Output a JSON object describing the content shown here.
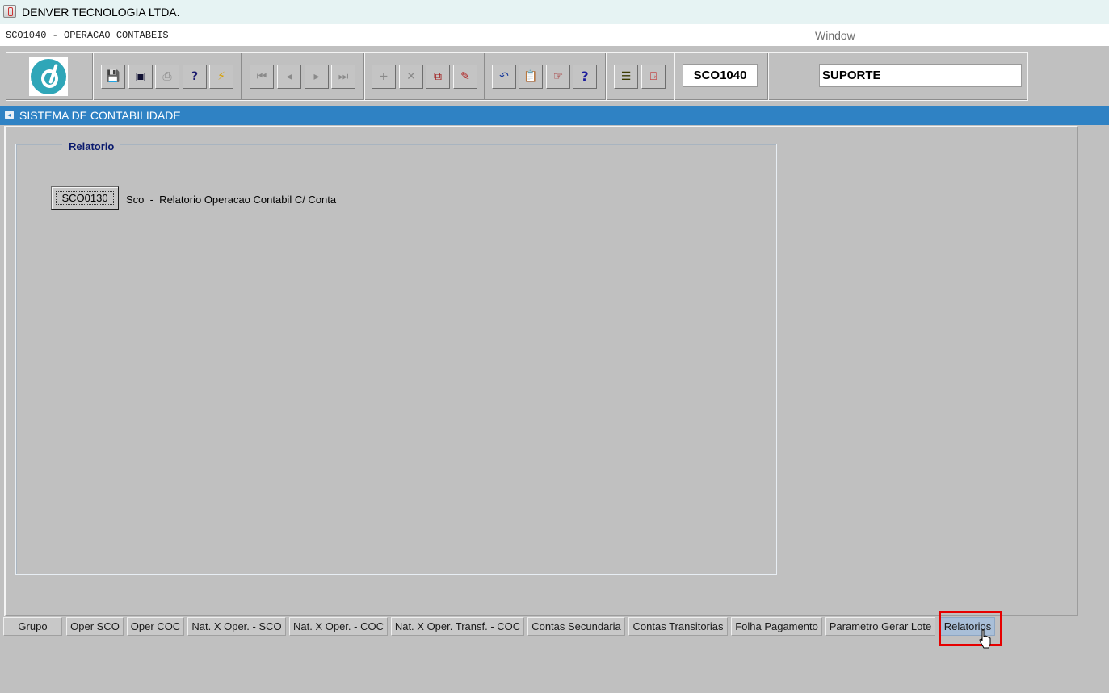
{
  "titlebar": {
    "title": "DENVER TECNOLOGIA LTDA.",
    "icon": "java-cup-icon"
  },
  "menubar": {
    "form_title": "SCO1040 - OPERACAO CONTABEIS",
    "window_menu": "Window"
  },
  "toolbar": {
    "logo": "denver-logo",
    "buttons": [
      {
        "icon": "save-icon",
        "glyph": "💾"
      },
      {
        "icon": "window-icon",
        "glyph": "▣"
      },
      {
        "icon": "print-icon",
        "glyph": "⎙"
      },
      {
        "icon": "query-help-icon",
        "glyph": "?"
      },
      {
        "icon": "execute-query-icon",
        "glyph": "⚡"
      },
      {
        "icon": "first-record-icon",
        "glyph": "⏮"
      },
      {
        "icon": "previous-record-icon",
        "glyph": "◂"
      },
      {
        "icon": "next-record-icon",
        "glyph": "▸"
      },
      {
        "icon": "last-record-icon",
        "glyph": "⏭"
      },
      {
        "icon": "insert-record-icon",
        "glyph": "+"
      },
      {
        "icon": "delete-record-icon",
        "glyph": "✕"
      },
      {
        "icon": "duplicate-record-icon",
        "glyph": "⧉"
      },
      {
        "icon": "edit-record-icon",
        "glyph": "✎"
      },
      {
        "icon": "undo-icon",
        "glyph": "↶"
      },
      {
        "icon": "clipboard-icon",
        "glyph": "📋"
      },
      {
        "icon": "list-values-icon",
        "glyph": "☞"
      },
      {
        "icon": "help-icon",
        "glyph": "?"
      },
      {
        "icon": "menu-icon",
        "glyph": "☰"
      },
      {
        "icon": "exit-icon",
        "glyph": "⍈"
      }
    ],
    "form_code": "SCO1040",
    "user": "SUPORTE"
  },
  "section": {
    "title": "SISTEMA DE CONTABILIDADE",
    "icon": "form-icon"
  },
  "group": {
    "label": "Relatorio",
    "report_button": "SCO0130",
    "report_description": "Sco  -  Relatorio Operacao Contabil C/ Conta"
  },
  "tabs": [
    {
      "label": "Grupo"
    },
    {
      "label": "Oper SCO"
    },
    {
      "label": "Oper COC"
    },
    {
      "label": "Nat. X Oper. - SCO"
    },
    {
      "label": "Nat. X Oper. - COC"
    },
    {
      "label": "Nat. X Oper. Transf. - COC"
    },
    {
      "label": "Contas Secundaria"
    },
    {
      "label": "Contas Transitorias"
    },
    {
      "label": "Folha Pagamento"
    },
    {
      "label": "Parametro Gerar Lote"
    },
    {
      "label": "Relatorios",
      "active": true
    }
  ],
  "colors": {
    "section_header": "#2f82c4",
    "highlight": "#e60000",
    "active_tab": "#a9bfd8",
    "group_label": "#0a1a6e"
  }
}
